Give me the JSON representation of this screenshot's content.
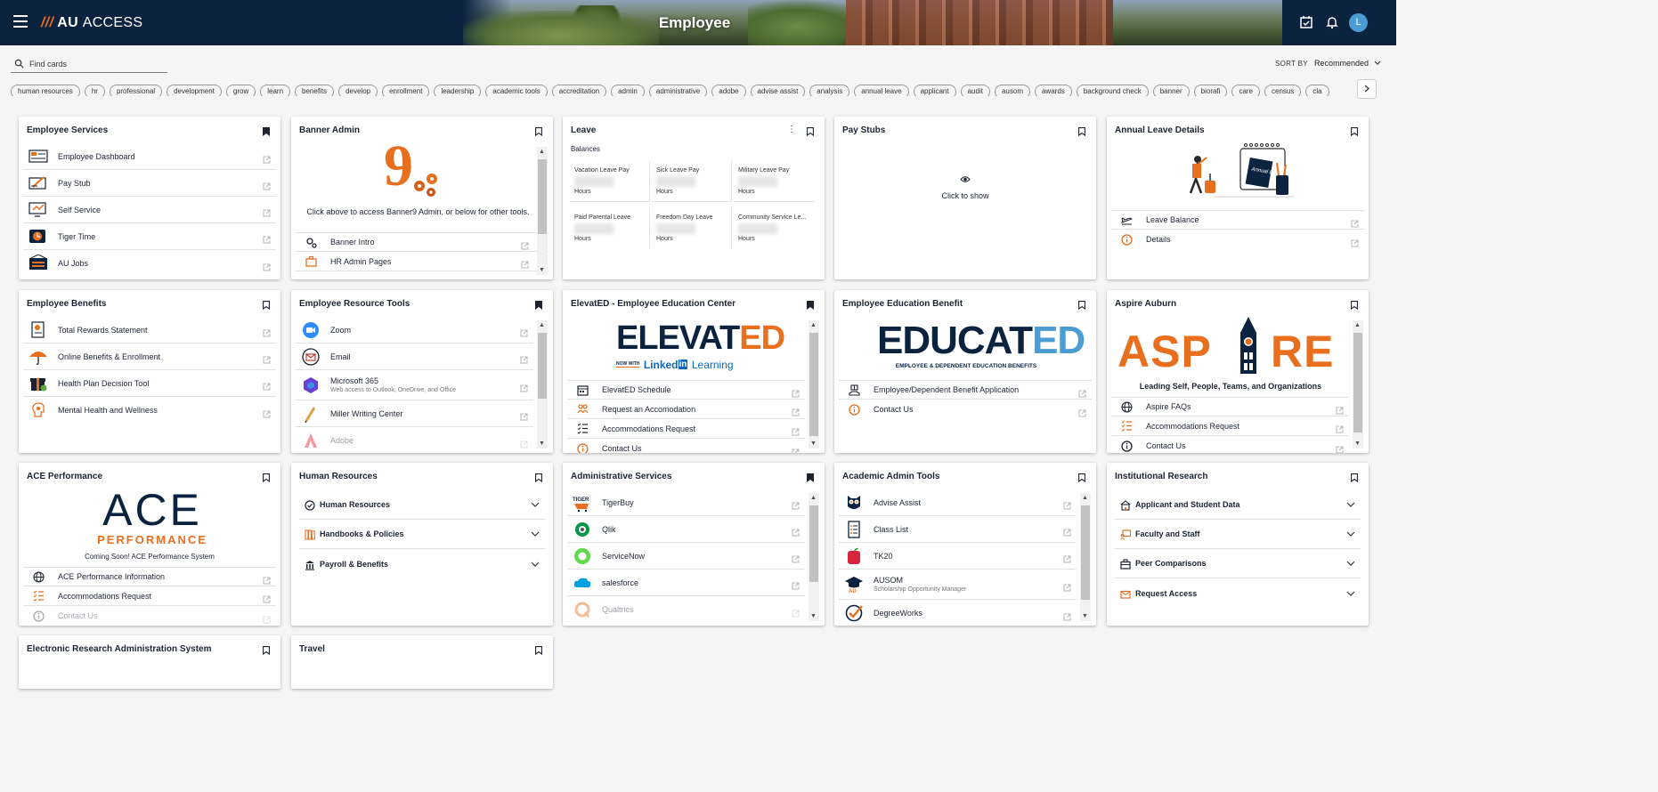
{
  "header": {
    "logo_slashes": "///",
    "logo_text": "AU ",
    "logo_light": "ACCESS",
    "page_title": "Employee",
    "avatar_initial": "L"
  },
  "search": {
    "placeholder": "Find cards"
  },
  "sort": {
    "label": "SORT BY",
    "value": "Recommended"
  },
  "chips": [
    "human resources",
    "hr",
    "professional",
    "development",
    "grow",
    "learn",
    "benefits",
    "develop",
    "enrollment",
    "leadership",
    "academic tools",
    "accreditation",
    "admin",
    "administrative",
    "adobe",
    "advise assist",
    "analysis",
    "annual leave",
    "applicant",
    "audit",
    "ausom",
    "awards",
    "background check",
    "banner",
    "biorafi",
    "care",
    "census",
    "cla"
  ],
  "cards": {
    "employee_services": {
      "title": "Employee Services",
      "links": [
        "Employee Dashboard",
        "Pay Stub",
        "Self Service",
        "Tiger Time",
        "AU Jobs"
      ]
    },
    "banner_admin": {
      "title": "Banner Admin",
      "logo_text": "9",
      "description": "Click above to access Banner9 Admin, or below for other tools.",
      "links": [
        "Banner Intro",
        "HR Admin Pages"
      ]
    },
    "leave": {
      "title": "Leave",
      "subtitle": "Balances",
      "cells": [
        {
          "label": "Vacation Leave Pay",
          "unit": "Hours"
        },
        {
          "label": "Sick Leave Pay",
          "unit": "Hours"
        },
        {
          "label": "Military Leave Pay",
          "unit": "Hours"
        },
        {
          "label": "Paid Parental Leave",
          "unit": "Hours"
        },
        {
          "label": "Freedom Day Leave",
          "unit": "Hours"
        },
        {
          "label": "Community Service Le...",
          "unit": "Hours"
        }
      ]
    },
    "pay_stubs": {
      "title": "Pay Stubs",
      "action": "Click to show"
    },
    "annual_leave": {
      "title": "Annual Leave Details",
      "clipboard_text": "Annual Leave",
      "links": [
        "Leave Balance",
        "Details"
      ]
    },
    "employee_benefits": {
      "title": "Employee Benefits",
      "links": [
        "Total Rewards Statement",
        "Online Benefits & Enrollment",
        "Health Plan Decision Tool",
        "Mental Health and Wellness"
      ]
    },
    "resource_tools": {
      "title": "Employee Resource Tools",
      "links": [
        {
          "label": "Zoom",
          "sub": ""
        },
        {
          "label": "Email",
          "sub": ""
        },
        {
          "label": "Microsoft 365",
          "sub": "Web access to Outlook, OneDrive, and Office"
        },
        {
          "label": "Miller Writing Center",
          "sub": ""
        },
        {
          "label": "Adobe",
          "sub": ""
        }
      ]
    },
    "elevated": {
      "title": "ElevatED - Employee Education Center",
      "logo_main": "ELEVAT",
      "logo_ed": "ED",
      "logo_now": "NOW WITH",
      "logo_linked": "Linked",
      "logo_in": "in",
      "logo_learning": "Learning",
      "links": [
        "ElevatED Schedule",
        "Request an Accomodation",
        "Accommodations Request",
        "Contact Us"
      ]
    },
    "educated": {
      "title": "Employee Education Benefit",
      "logo_main": "EDUCAT",
      "logo_ed": "ED",
      "logo_sub": "EMPLOYEE & DEPENDENT EDUCATION BENEFITS",
      "links": [
        "Employee/Dependent Benefit Application",
        "Contact Us"
      ]
    },
    "aspire": {
      "title": "Aspire Auburn",
      "logo_left": "ASP",
      "logo_right": "RE",
      "tagline": "Leading Self, People, Teams, and Organizations",
      "links": [
        "Aspire FAQs",
        "Accommodations Request",
        "Contact Us"
      ]
    },
    "ace": {
      "title": "ACE Performance",
      "logo_main": "ACE",
      "logo_sub": "PERFORMANCE",
      "tagline": "Coming Soon! ACE Performance System",
      "links": [
        "ACE Performance Information",
        "Accommodations Request",
        "Contact Us"
      ]
    },
    "human_resources": {
      "title": "Human Resources",
      "sections": [
        "Human Resources",
        "Handbooks & Policies",
        "Payroll & Benefits"
      ]
    },
    "admin_services": {
      "title": "Administrative Services",
      "links": [
        "TigerBuy",
        "Qlik",
        "ServiceNow",
        "salesforce",
        "Qualtrics"
      ]
    },
    "academic_admin": {
      "title": "Academic Admin Tools",
      "links": [
        {
          "label": "Advise Assist",
          "sub": ""
        },
        {
          "label": "Class List",
          "sub": ""
        },
        {
          "label": "TK20",
          "sub": ""
        },
        {
          "label": "AUSOM",
          "sub": "Scholarship Opportunity Manager"
        },
        {
          "label": "DegreeWorks",
          "sub": ""
        }
      ]
    },
    "institutional_research": {
      "title": "Institutional Research",
      "sections": [
        "Applicant and Student Data",
        "Faculty and Staff",
        "Peer Comparisons",
        "Request Access"
      ]
    },
    "eras": {
      "title": "Electronic Research Administration System"
    },
    "travel": {
      "title": "Travel"
    }
  },
  "colors": {
    "navy": "#0c2340",
    "orange": "#e86f1d",
    "blue": "#4b9cd3"
  }
}
